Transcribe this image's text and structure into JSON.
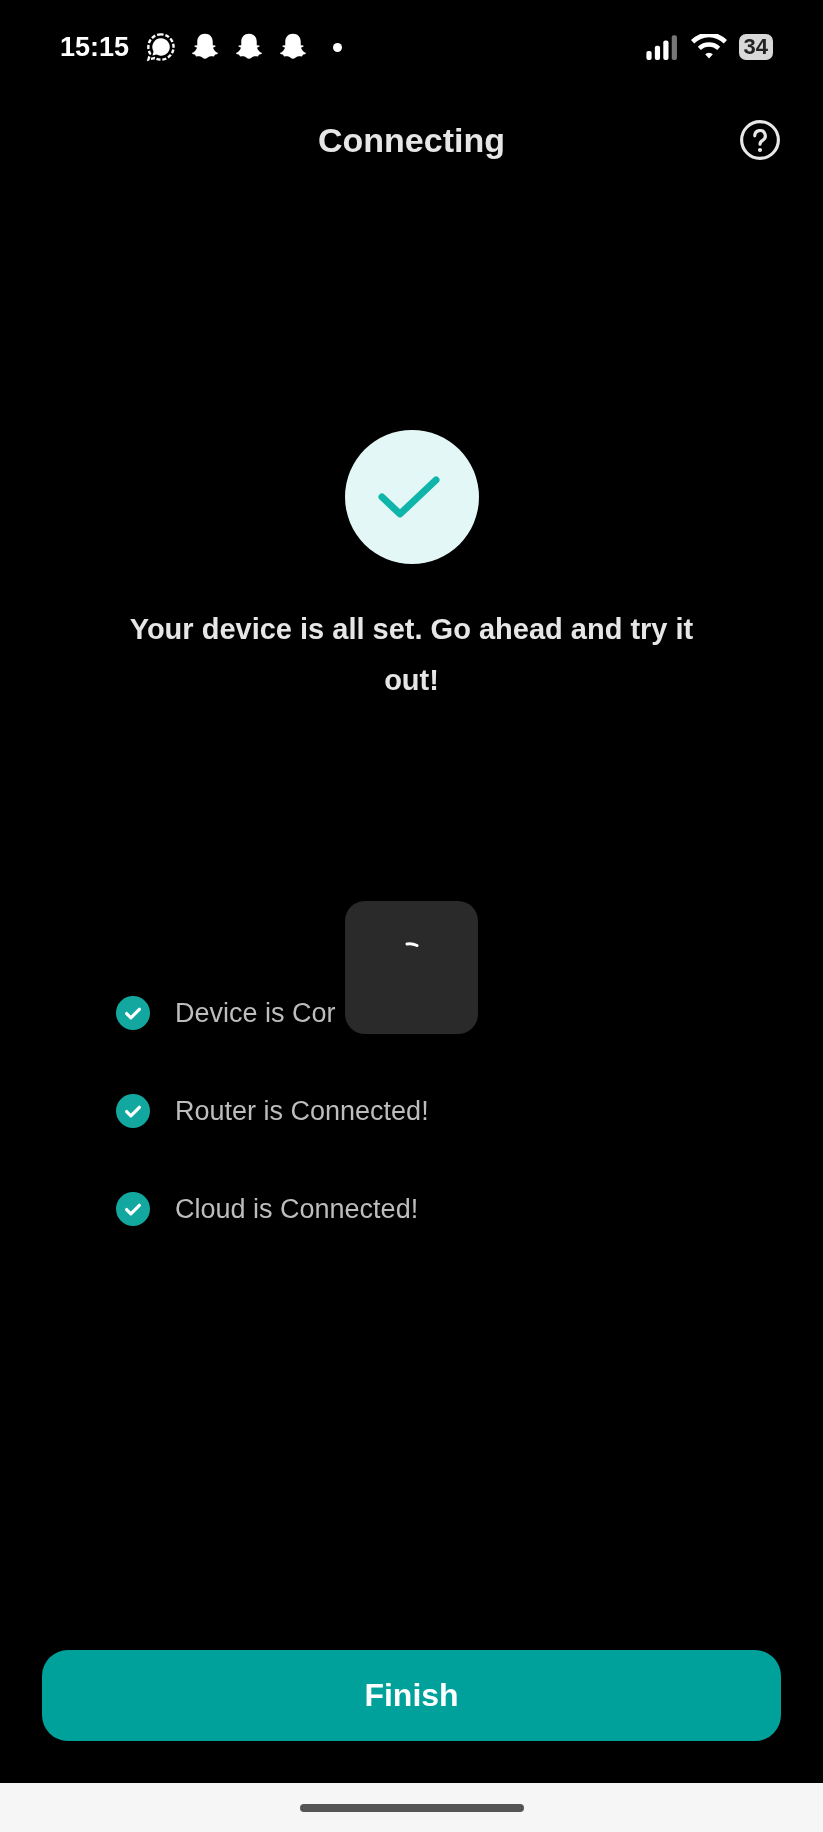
{
  "status_bar": {
    "time": "15:15",
    "notification_icons": [
      {
        "kind": "chat"
      },
      {
        "kind": "ghost"
      },
      {
        "kind": "ghost"
      },
      {
        "kind": "ghost"
      },
      {
        "kind": "dot"
      }
    ],
    "battery": "34"
  },
  "header": {
    "title": "Connecting"
  },
  "message": "Your device is all set. Go ahead and try it out!",
  "loading_overlay": {
    "kind": "spinner"
  },
  "steps": [
    {
      "label": "Device is Cor",
      "checked": true
    },
    {
      "label": "Router is Connected!",
      "checked": true
    },
    {
      "label": "Cloud is Connected!",
      "checked": true
    }
  ],
  "finish_button": {
    "label": "Finish"
  }
}
